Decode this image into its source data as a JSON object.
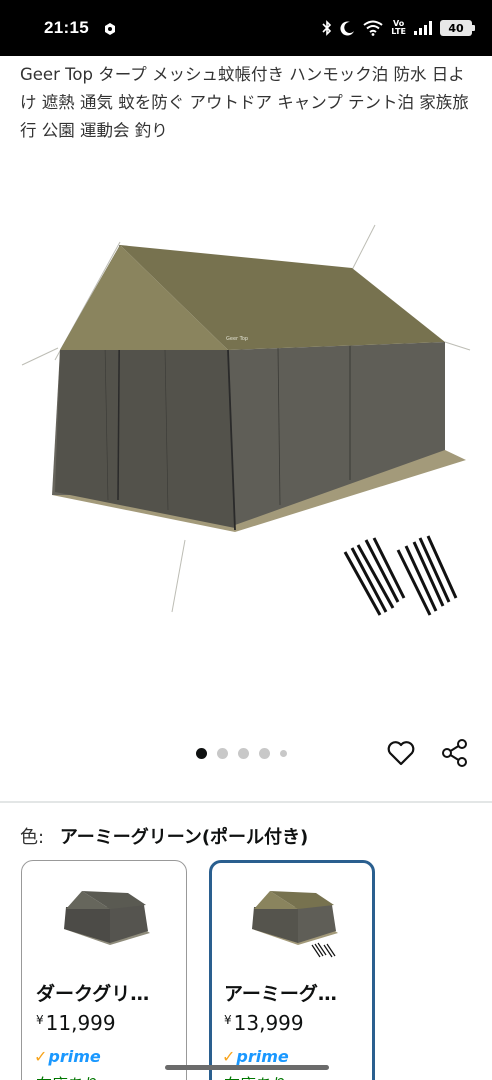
{
  "status_bar": {
    "time": "21:15",
    "battery": "40",
    "volte_top": "Vo",
    "volte_bottom": "LTE"
  },
  "product": {
    "title": "Geer Top タープ メッシュ蚊帳付き ハンモック泊 防水 日よけ 遮熱 通気 蚊を防ぐ アウトドア キャンプ テント泊 家族旅行 公園 運動会 釣り",
    "image_icon": "tent-photo",
    "image_count": 5,
    "active_image_index": 0
  },
  "actions": {
    "wishlist_icon": "heart-icon",
    "share_icon": "share-icon"
  },
  "color_selector": {
    "label": "色:",
    "selected_value": "アーミーグリーン(ポール付き)"
  },
  "variants": [
    {
      "name": "ダークグリ…",
      "currency": "¥",
      "price": "11,999",
      "prime_check": "✓",
      "prime_label": "prime",
      "stock": "在庫あり",
      "selected": false
    },
    {
      "name": "アーミーグ…",
      "currency": "¥",
      "price": "13,999",
      "prime_check": "✓",
      "prime_label": "prime",
      "stock": "在庫あり",
      "selected": true
    }
  ],
  "colors": {
    "tent_fabric": "#6e6b4a",
    "mesh": "#55544d",
    "selected_border": "#2a5f8f",
    "prime_blue": "#1a98ff",
    "prime_check": "#f7a41d",
    "in_stock": "#007600"
  }
}
